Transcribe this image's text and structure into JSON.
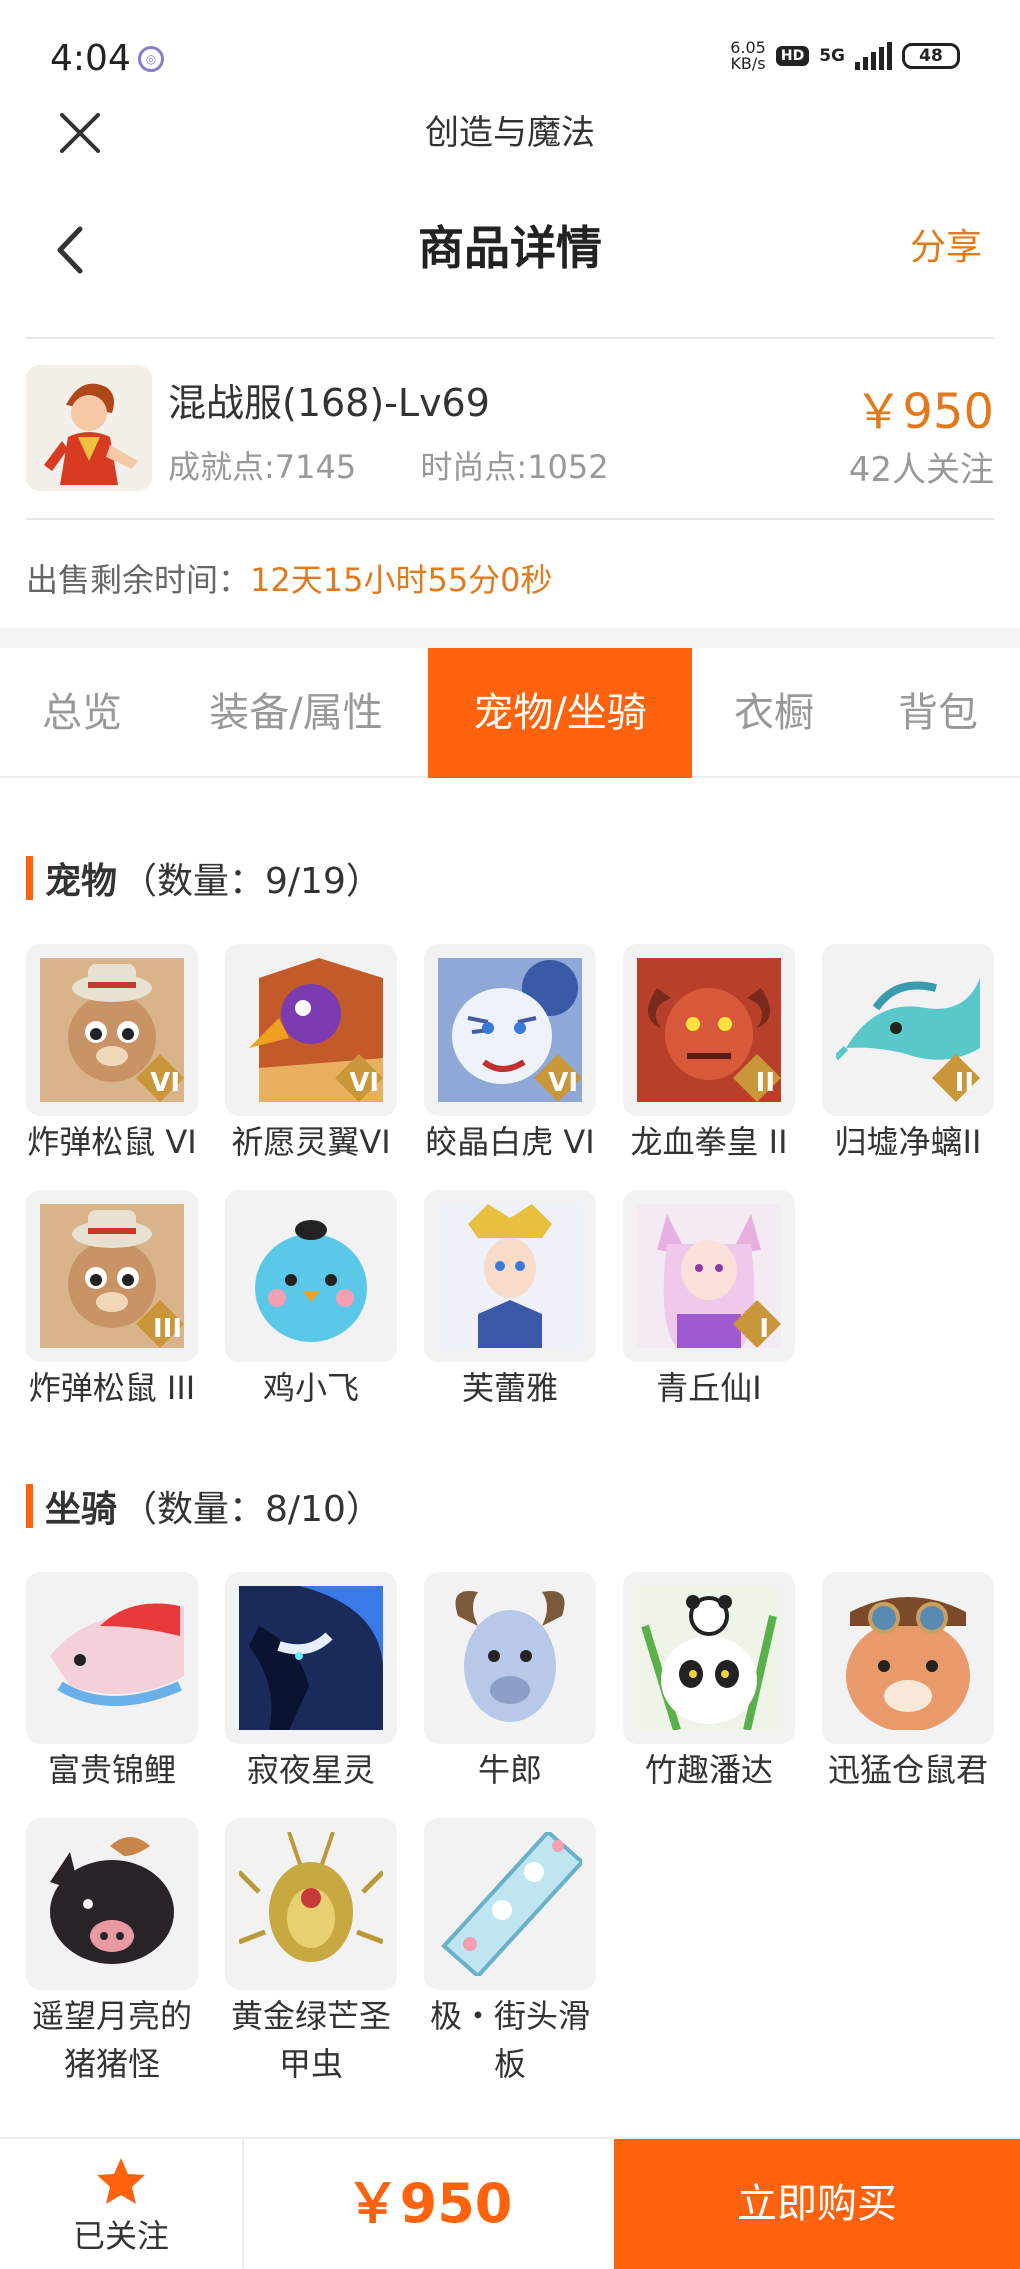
{
  "status_bar": {
    "time": "4:04",
    "net_speed_value": "6.05",
    "net_speed_unit": "KB/s",
    "hd_badge": "HD",
    "network": "5G",
    "battery": "48"
  },
  "webview": {
    "title": "创造与魔法"
  },
  "nav": {
    "title": "商品详情",
    "share_label": "分享"
  },
  "product": {
    "name": "混战服(168)-Lv69",
    "achievement": "成就点:7145",
    "fashion": "时尚点:1052",
    "price": "￥950",
    "followers": "42人关注"
  },
  "sale": {
    "label": "出售剩余时间：",
    "remaining": "12天15小时55分0秒"
  },
  "tabs": [
    {
      "label": "总览"
    },
    {
      "label": "装备/属性"
    },
    {
      "label": "宠物/坐骑"
    },
    {
      "label": "衣橱"
    },
    {
      "label": "背包"
    }
  ],
  "active_tab": "宠物/坐骑",
  "pets": {
    "heading": "宠物",
    "count": "（数量：9/19）",
    "items": [
      {
        "name": "炸弹松鼠 VI",
        "badge": "VI"
      },
      {
        "name": "祈愿灵翼VI",
        "badge": "VI"
      },
      {
        "name": "皎晶白虎 VI",
        "badge": "VI"
      },
      {
        "name": "龙血拳皇 II",
        "badge": "II"
      },
      {
        "name": "归墟净螭II",
        "badge": "II"
      },
      {
        "name": "炸弹松鼠 III",
        "badge": "III"
      },
      {
        "name": "鸡小飞",
        "badge": ""
      },
      {
        "name": "芙蕾雅",
        "badge": ""
      },
      {
        "name": "青丘仙I",
        "badge": "I"
      }
    ]
  },
  "mounts": {
    "heading": "坐骑",
    "count": "（数量：8/10）",
    "items": [
      {
        "name": "富贵锦鲤"
      },
      {
        "name": "寂夜星灵"
      },
      {
        "name": "牛郎"
      },
      {
        "name": "竹趣潘达"
      },
      {
        "name": "迅猛仓鼠君"
      },
      {
        "name": "遥望月亮的猪猪怪"
      },
      {
        "name": "黄金绿芒圣甲虫"
      },
      {
        "name": "极・街头滑板"
      }
    ]
  },
  "bottom_bar": {
    "follow_label": "已关注",
    "price": "￥950",
    "buy_label": "立即购买"
  },
  "colors": {
    "accent": "#ff620c",
    "price": "#e27a1c",
    "muted": "#999999"
  }
}
